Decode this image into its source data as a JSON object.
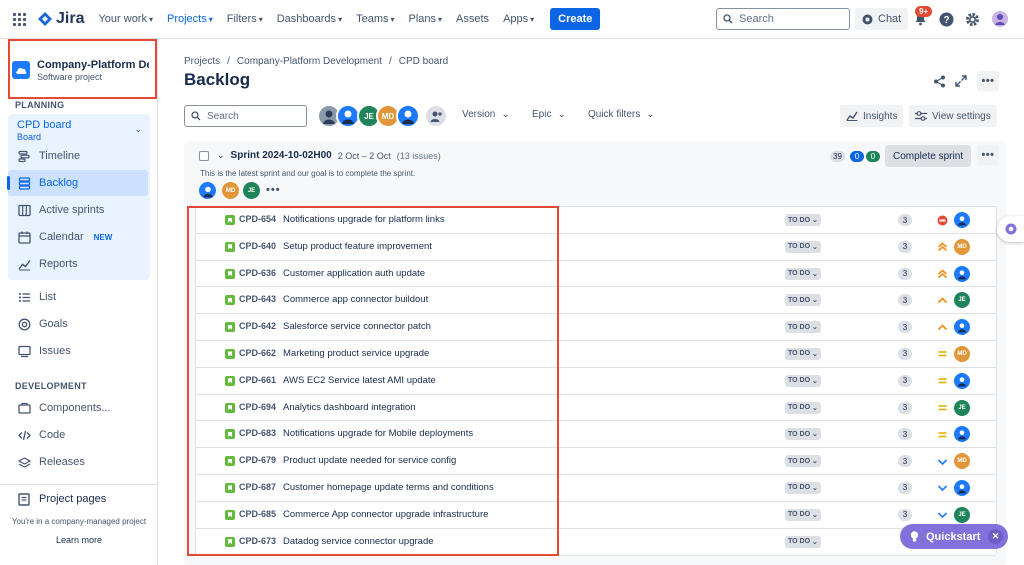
{
  "topnav": {
    "logo": "Jira",
    "items": [
      {
        "label": "Your work",
        "active": false
      },
      {
        "label": "Projects",
        "active": true
      },
      {
        "label": "Filters",
        "active": false
      },
      {
        "label": "Dashboards",
        "active": false
      },
      {
        "label": "Teams",
        "active": false
      },
      {
        "label": "Plans",
        "active": false
      },
      {
        "label": "Assets",
        "active": false
      },
      {
        "label": "Apps",
        "active": false
      }
    ],
    "create_label": "Create",
    "search_placeholder": "Search",
    "chat_label": "Chat",
    "notification_badge": "9+"
  },
  "sidebar": {
    "project_name": "Company-Platform Development",
    "project_type": "Software project",
    "planning_label": "PLANNING",
    "board_title": "CPD board",
    "board_sub": "Board",
    "planning_items": [
      {
        "label": "Timeline",
        "icon": "timeline-icon"
      },
      {
        "label": "Backlog",
        "icon": "backlog-icon",
        "active": true
      },
      {
        "label": "Active sprints",
        "icon": "sprints-icon"
      },
      {
        "label": "Calendar",
        "icon": "calendar-icon",
        "tag": "NEW"
      },
      {
        "label": "Reports",
        "icon": "reports-icon"
      }
    ],
    "other_items": [
      {
        "label": "List",
        "icon": "list-icon"
      },
      {
        "label": "Goals",
        "icon": "goals-icon"
      },
      {
        "label": "Issues",
        "icon": "issues-icon"
      }
    ],
    "development_label": "DEVELOPMENT",
    "dev_items": [
      {
        "label": "Components...",
        "icon": "components-icon"
      },
      {
        "label": "Code",
        "icon": "code-icon"
      },
      {
        "label": "Releases",
        "icon": "releases-icon"
      }
    ],
    "project_pages": "Project pages",
    "footer_text": "You're in a company-managed project",
    "learn_more": "Learn more"
  },
  "main": {
    "breadcrumb": [
      "Projects",
      "Company-Platform Development",
      "CPD board"
    ],
    "title": "Backlog",
    "search_placeholder": "Search",
    "avatars": [
      "",
      "",
      "JE",
      "MD",
      ""
    ],
    "filters": [
      "Version",
      "Epic",
      "Quick filters"
    ],
    "insights_label": "Insights",
    "view_settings_label": "View settings"
  },
  "sprint": {
    "name": "Sprint 2024-10-02H00",
    "dates": "2 Oct – 2 Oct",
    "count": "(13 issues)",
    "goal": "This is the latest sprint and our goal is to complete the sprint.",
    "points_todo": "39",
    "points_progress": "0",
    "points_done": "0",
    "complete_label": "Complete sprint"
  },
  "issues": [
    {
      "key": "CPD-654",
      "summary": "Notifications upgrade for platform links",
      "status": "TO DO",
      "points": "3",
      "priority": "blocker",
      "assignee": ""
    },
    {
      "key": "CPD-640",
      "summary": "Setup product feature improvement",
      "status": "TO DO",
      "points": "3",
      "priority": "highest",
      "assignee": "MD"
    },
    {
      "key": "CPD-636",
      "summary": "Customer application auth update",
      "status": "TO DO",
      "points": "3",
      "priority": "highest",
      "assignee": ""
    },
    {
      "key": "CPD-643",
      "summary": "Commerce app connector buildout",
      "status": "TO DO",
      "points": "3",
      "priority": "high",
      "assignee": "JE"
    },
    {
      "key": "CPD-642",
      "summary": "Salesforce service connector patch",
      "status": "TO DO",
      "points": "3",
      "priority": "high",
      "assignee": ""
    },
    {
      "key": "CPD-662",
      "summary": "Marketing product service upgrade",
      "status": "TO DO",
      "points": "3",
      "priority": "medium",
      "assignee": "MD"
    },
    {
      "key": "CPD-661",
      "summary": "AWS EC2 Service latest AMI update",
      "status": "TO DO",
      "points": "3",
      "priority": "medium",
      "assignee": ""
    },
    {
      "key": "CPD-694",
      "summary": "Analytics dashboard integration",
      "status": "TO DO",
      "points": "3",
      "priority": "medium",
      "assignee": "JE"
    },
    {
      "key": "CPD-683",
      "summary": "Notifications upgrade for Mobile deployments",
      "status": "TO DO",
      "points": "3",
      "priority": "medium",
      "assignee": ""
    },
    {
      "key": "CPD-679",
      "summary": "Product update needed for service config",
      "status": "TO DO",
      "points": "3",
      "priority": "low",
      "assignee": "MD"
    },
    {
      "key": "CPD-687",
      "summary": "Customer homepage update terms and conditions",
      "status": "TO DO",
      "points": "3",
      "priority": "low",
      "assignee": ""
    },
    {
      "key": "CPD-685",
      "summary": "Commerce App connector upgrade infrastructure",
      "status": "TO DO",
      "points": "3",
      "priority": "low",
      "assignee": "JE"
    },
    {
      "key": "CPD-673",
      "summary": "Datadog service connector upgrade",
      "status": "TO DO",
      "points": "",
      "priority": "",
      "assignee": ""
    }
  ],
  "quickstart_label": "Quickstart",
  "colors": {
    "accent": "#0c66e4",
    "story": "#63ba3c",
    "highlight": "#e34935",
    "quickstart": "#8270db"
  }
}
